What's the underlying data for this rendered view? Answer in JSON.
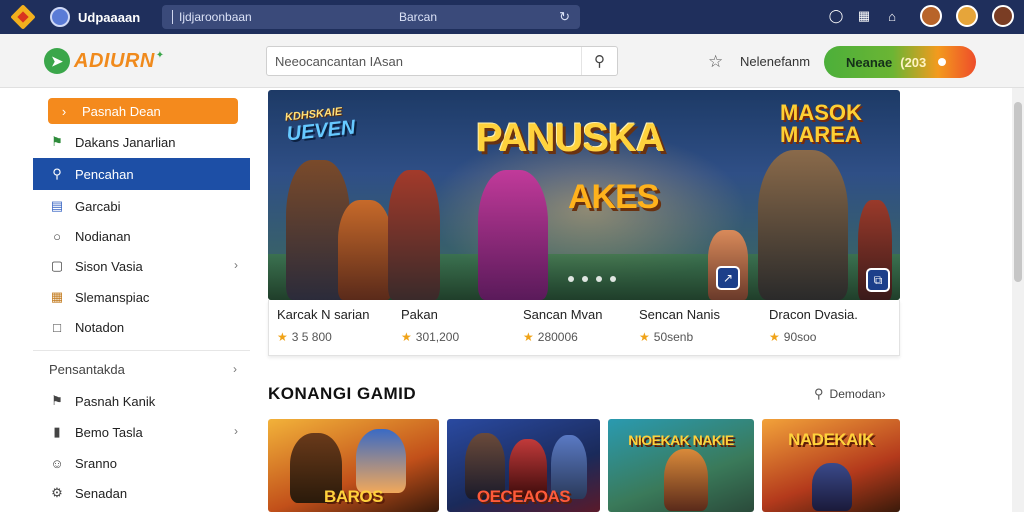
{
  "chrome": {
    "tab_title": "Udpaaaan",
    "address_url": "Ijdjaroonbaan",
    "address_hint": "Barcan"
  },
  "header": {
    "brand_name": "ADIURN",
    "search_placeholder": "Neeocancantan IAsan",
    "favorite_label": "Nelenefanm",
    "cta_label": "Neanae",
    "cta_count": "(203"
  },
  "sidebar": {
    "items": [
      {
        "label": "Pasnah Dean",
        "icon": "chevron-right-icon"
      },
      {
        "label": "Dakans Janarlian",
        "icon": "flag-icon"
      },
      {
        "label": "Pencahan",
        "icon": "search-icon"
      },
      {
        "label": "Garcabi",
        "icon": "calendar-icon"
      },
      {
        "label": "Nodianan",
        "icon": "globe-icon"
      },
      {
        "label": "Sison Vasia",
        "icon": "gamepad-icon"
      },
      {
        "label": "Slemanspiac",
        "icon": "grid-icon"
      },
      {
        "label": "Notadon",
        "icon": "document-icon"
      }
    ],
    "section_heading": "Pensantakda",
    "section_items": [
      {
        "label": "Pasnah Kanik",
        "icon": "bookmark-icon"
      },
      {
        "label": "Bemo Tasla",
        "icon": "chart-icon"
      },
      {
        "label": "Sranno",
        "icon": "users-icon"
      },
      {
        "label": "Senadan",
        "icon": "settings-icon"
      }
    ]
  },
  "hero": {
    "tag_left": "UEVEN",
    "tag_left_top": "KDHSKAIE",
    "title": "PANUSKA",
    "subtitle": "AKES",
    "tag_right_line1": "MASOK",
    "tag_right_line2": "MAREA"
  },
  "featured": [
    {
      "name": "Karcak N sarian",
      "meta": "3 5 800"
    },
    {
      "name": "Pakan",
      "meta": "301,200"
    },
    {
      "name": "Sancan Mvan",
      "meta": "280006"
    },
    {
      "name": "Sencan Nanis",
      "meta": "50senb"
    },
    {
      "name": "Dracon Dvasia.",
      "meta": "90soo"
    }
  ],
  "section": {
    "title": "KONANGI GAMID",
    "link": "Demodan"
  },
  "cards": [
    {
      "title": "BAROS",
      "color": "#e07a1e"
    },
    {
      "title": "OECEAOAS",
      "color": "#2c4fa1"
    },
    {
      "title": "NIOEKAK NAKIE",
      "color": "#2f8a8c"
    },
    {
      "title": "NADEKAIK",
      "color": "#b43a1c"
    }
  ],
  "colors": {
    "chrome_bg": "#1f2f5c",
    "active_nav": "#1d4fa6",
    "highlight_nav": "#f48a1d",
    "brand": "#f08a1c"
  }
}
